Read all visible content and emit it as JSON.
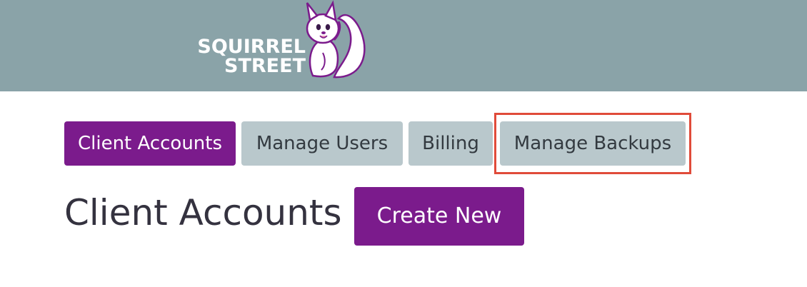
{
  "brand": {
    "line1": "SQUIRREL",
    "line2": "STREET",
    "mascot": "squirrel-logo-icon",
    "colors": {
      "header_bg": "#8aa3a8",
      "primary": "#7b1b8c",
      "tab_bg": "#b9c8cc",
      "highlight": "#e04b3a"
    }
  },
  "nav": {
    "tabs": [
      {
        "label": "Client Accounts",
        "active": true
      },
      {
        "label": "Manage Users",
        "active": false
      },
      {
        "label": "Billing",
        "active": false
      },
      {
        "label": "Manage Backups",
        "active": false,
        "highlighted": true
      }
    ]
  },
  "main": {
    "title": "Client Accounts",
    "create_label": "Create New"
  }
}
